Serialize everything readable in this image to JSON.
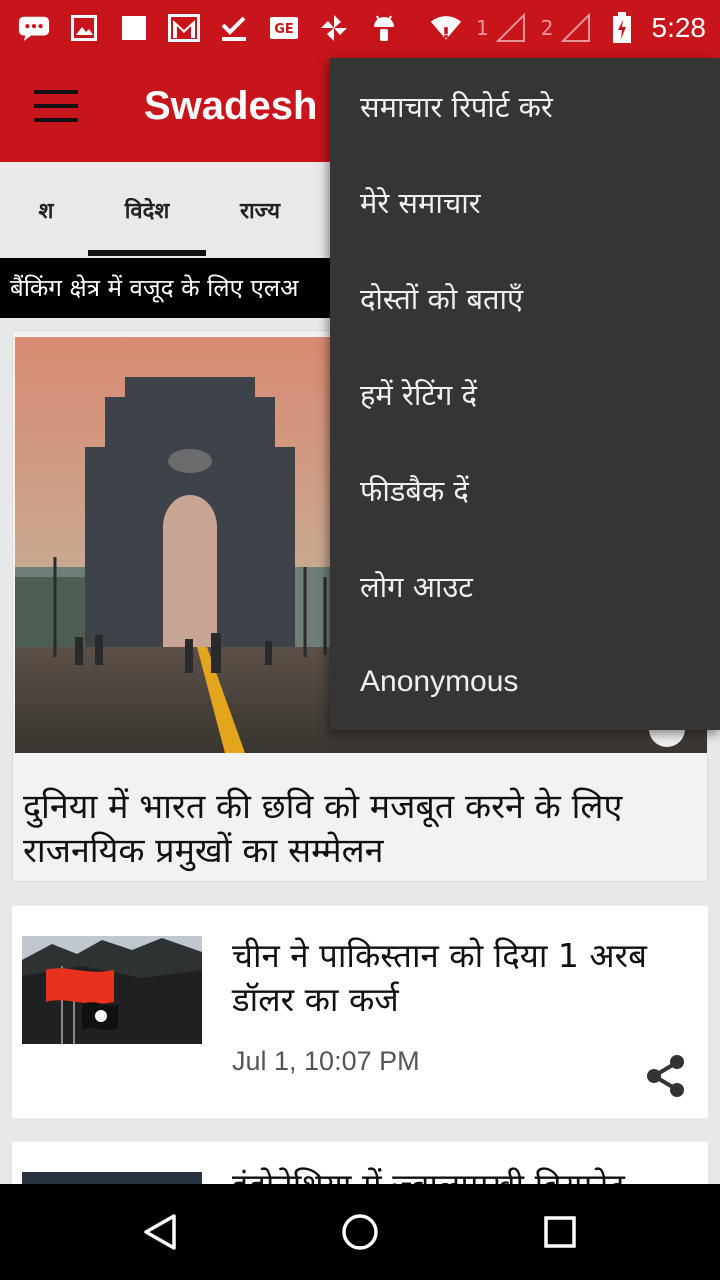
{
  "status_bar": {
    "time": "5:28",
    "sim1": "1",
    "sim2": "2",
    "icons": [
      "chat-icon",
      "image-icon",
      "square-icon",
      "gmail-icon",
      "check-icon",
      "ge-icon",
      "pinwheel-icon",
      "android-icon",
      "wifi-icon",
      "signal-icon",
      "signal-icon",
      "battery-icon"
    ],
    "color": "#c8141b"
  },
  "app_bar": {
    "title": "Swadesh",
    "color": "#c8141b"
  },
  "tabs": [
    {
      "label": "श"
    },
    {
      "label": "विदेश",
      "selected": true
    },
    {
      "label": "राज्य"
    }
  ],
  "ticker": {
    "text": "बैंकिंग क्षेत्र में वजूद के लिए एलअ"
  },
  "featured": {
    "headline": "दुनिया में भारत की छवि को मजबूत करने के लिए राजनयिक प्रमुखों का सम्मेलन"
  },
  "list": [
    {
      "headline": "चीन ने पाकिस्तान को दिया 1 अरब डॉलर का कर्ज",
      "time": "Jul 1, 10:07 PM"
    },
    {
      "headline": "इंडोनेशिया में ज्वालामुखी विस्फोट"
    }
  ],
  "menu": {
    "items": [
      {
        "label": "समाचार रिपोर्ट करे"
      },
      {
        "label": "मेरे समाचार"
      },
      {
        "label": "दोस्तों को बताएँ"
      },
      {
        "label": "हमें रेटिंग दें"
      },
      {
        "label": "फीडबैक दें"
      },
      {
        "label": "लोग आउट"
      },
      {
        "label": "Anonymous"
      }
    ]
  },
  "nav": {
    "buttons": [
      "back-icon",
      "home-icon",
      "recents-icon"
    ]
  }
}
